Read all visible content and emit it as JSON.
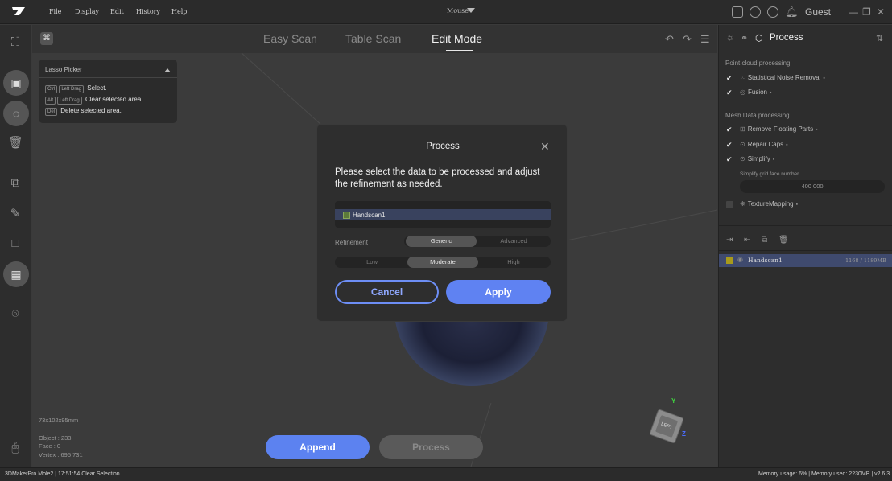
{
  "menu": {
    "file": "File",
    "display": "Display",
    "edit": "Edit",
    "history": "History",
    "help": "Help"
  },
  "mode_select": "Mouse",
  "user": "Guest",
  "tabs": [
    {
      "label": "Easy Scan"
    },
    {
      "label": "Table Scan"
    },
    {
      "label": "Edit Mode"
    }
  ],
  "lasso": {
    "title": "Lasso Picker",
    "rows": [
      {
        "keys": [
          "Ctrl",
          "Left Drag"
        ],
        "text": "Select."
      },
      {
        "keys": [
          "Alt",
          "Left Drag"
        ],
        "text": "Clear selected area."
      },
      {
        "keys": [
          "Del"
        ],
        "text": "Delete selected area."
      }
    ]
  },
  "stats": {
    "dims": "73x102x95mm",
    "object": "Object : 233",
    "face": "Face : 0",
    "vertex": "Vertex : 695 731"
  },
  "bottom": {
    "append": "Append",
    "process": "Process"
  },
  "dialog": {
    "title": "Process",
    "message": "Please select the data to be processed and adjust the refinement as needed.",
    "item": "Handscan1",
    "refinement_label": "Refinement",
    "mode_options": [
      "Generic",
      "Advanced"
    ],
    "mode_selected": "Generic",
    "level_options": [
      "Low",
      "Moderate",
      "High"
    ],
    "level_selected": "Moderate",
    "cancel": "Cancel",
    "apply": "Apply"
  },
  "right_panel": {
    "title": "Process",
    "section1": "Point cloud processing",
    "snr": "Statistical Noise Removal",
    "fusion": "Fusion",
    "section2": "Mesh Data processing",
    "rfp": "Remove Floating Parts",
    "repair": "Repair Caps",
    "simplify": "Simplify",
    "grid_label": "Simplify grid face number",
    "grid_value": "400 000",
    "texture": "TextureMapping",
    "row_name": "Handscan1",
    "row_size": "1168 / 1189MB"
  },
  "axis": {
    "x": "Y",
    "z": "Z"
  },
  "cube_label": "LEFT",
  "status": {
    "left": "3DMakerPro Mole2 | 17:51:54 Clear Selection",
    "right": "Memory usage: 6% | Memory used: 2230MB | v2.6.3"
  }
}
